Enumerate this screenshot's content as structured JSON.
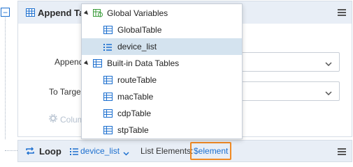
{
  "card": {
    "title": "Append Table",
    "append_label": "Append",
    "target_label": "To Target",
    "columns_label": "Columns"
  },
  "dropdown": {
    "groups": [
      {
        "label": "Global Variables",
        "icon": "global-variables-icon",
        "items": [
          {
            "label": "GlobalTable",
            "icon": "table-icon",
            "selected": false
          },
          {
            "label": "device_list",
            "icon": "list-icon",
            "selected": true
          }
        ]
      },
      {
        "label": "Built-in Data Tables",
        "icon": "table-icon",
        "items": [
          {
            "label": "routeTable",
            "icon": "table-icon",
            "selected": false
          },
          {
            "label": "macTable",
            "icon": "table-icon",
            "selected": false
          },
          {
            "label": "cdpTable",
            "icon": "table-icon",
            "selected": false
          },
          {
            "label": "stpTable",
            "icon": "table-icon",
            "selected": false
          }
        ]
      }
    ]
  },
  "loop": {
    "title": "Loop",
    "variable": "device_list",
    "list_elements_label": "List Elements:",
    "element_token": "$element"
  },
  "colors": {
    "accent": "#1c6fcf",
    "header_bg": "#e8eef6",
    "selected_bg": "#d4e3ef",
    "highlight_border": "#f08a24"
  }
}
